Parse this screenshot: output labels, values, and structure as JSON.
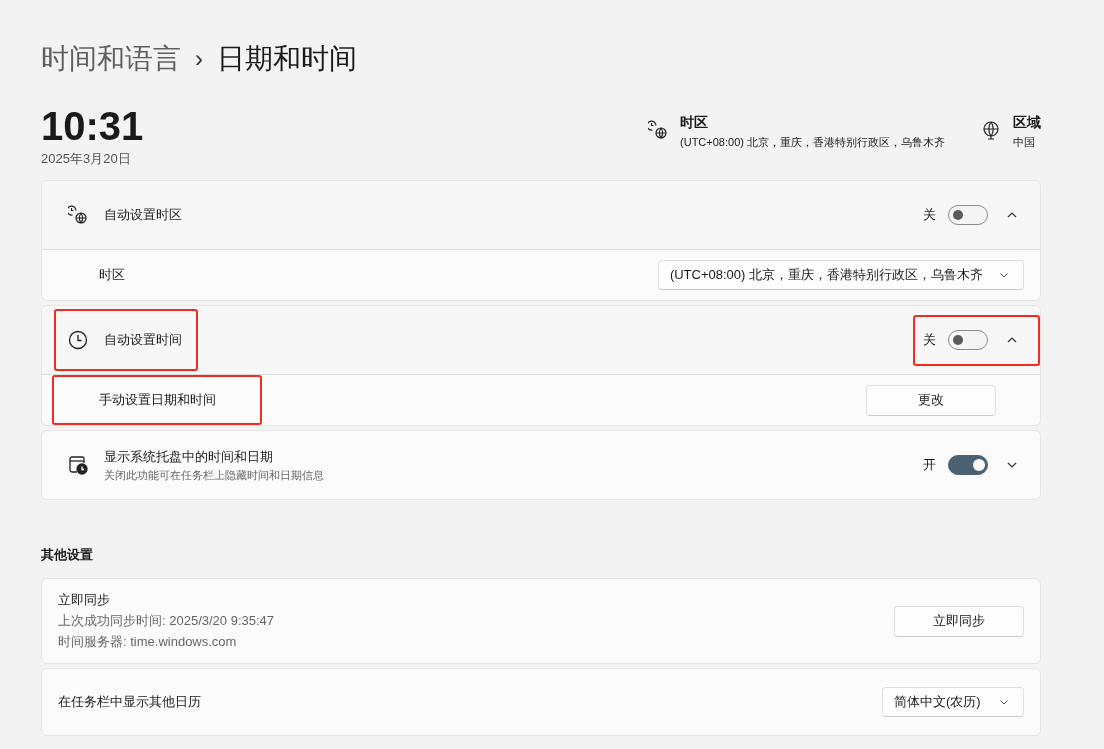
{
  "breadcrumb": {
    "parent": "时间和语言",
    "separator": "›",
    "current": "日期和时间"
  },
  "clock": {
    "time": "10:31",
    "date": "2025年3月20日"
  },
  "summary": [
    {
      "kind": "timezone",
      "label": "时区",
      "value": "(UTC+08:00) 北京，重庆，香港特别行政区，乌鲁木齐"
    },
    {
      "kind": "region",
      "label": "区域",
      "value": "中国"
    }
  ],
  "settings": [
    {
      "kind": "timezone",
      "title": "自动设置时区",
      "state_label": "关",
      "on": false,
      "expanded": true,
      "highlighted": false,
      "controls_highlighted": false,
      "children": [
        {
          "kind": "dropdown",
          "label": "时区",
          "value": "(UTC+08:00) 北京，重庆，香港特别行政区，乌鲁木齐",
          "highlighted": false
        }
      ]
    },
    {
      "kind": "time",
      "title": "自动设置时间",
      "state_label": "关",
      "on": false,
      "expanded": true,
      "highlighted": true,
      "controls_highlighted": true,
      "children": [
        {
          "kind": "button",
          "label": "手动设置日期和时间",
          "value": "更改",
          "highlighted": true
        }
      ]
    },
    {
      "kind": "tray",
      "title": "显示系统托盘中的时间和日期",
      "subtitle": "关闭此功能可在任务栏上隐藏时间和日期信息",
      "state_label": "开",
      "on": true,
      "expanded": false,
      "highlighted": false,
      "controls_highlighted": false
    }
  ],
  "other_section": {
    "title": "其他设置",
    "items": [
      {
        "kind": "button",
        "title": "立即同步",
        "lines": [
          "上次成功同步时间: 2025/3/20 9:35:47",
          "时间服务器: time.windows.com"
        ],
        "value": "立即同步"
      },
      {
        "kind": "dropdown",
        "title": "在任务栏中显示其他日历",
        "value": "简体中文(农历)"
      }
    ]
  }
}
